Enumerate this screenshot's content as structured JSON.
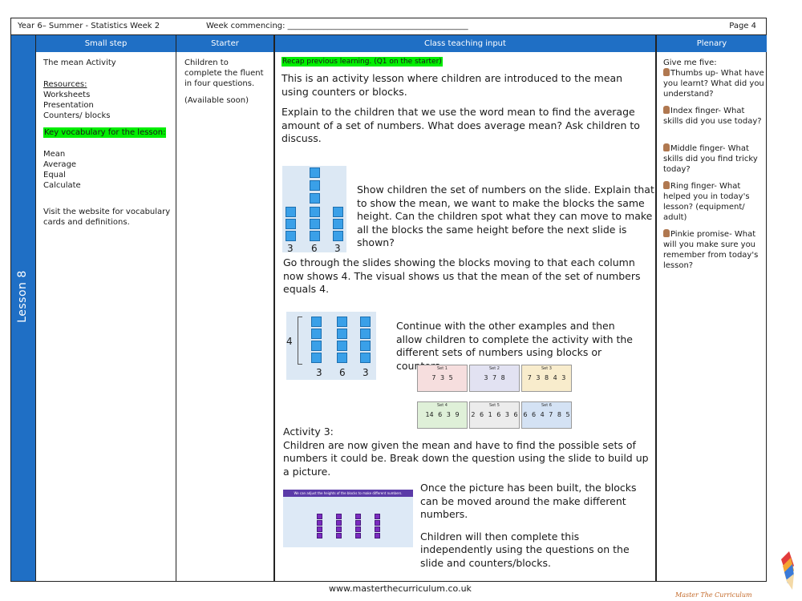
{
  "header": {
    "title": "Year 6– Summer - Statistics Week 2",
    "week_commencing": "Week commencing: _____________________________________________",
    "page": "Page 4"
  },
  "columns": {
    "small_step": "Small step",
    "starter": "Starter",
    "class_teaching": "Class teaching input",
    "plenary": "Plenary"
  },
  "lesson_label": "Lesson 8",
  "small_step": {
    "title": "The mean Activity",
    "resources_heading": "Resources:",
    "resources": [
      "Worksheets",
      "Presentation",
      "Counters/ blocks"
    ],
    "key_vocab_heading": "Key vocabulary for the lesson:",
    "vocab": [
      "Mean",
      "Average",
      "Equal",
      "Calculate"
    ],
    "website_note": "Visit the website for vocabulary cards and definitions."
  },
  "starter": {
    "text": "Children to complete the fluent in four questions.",
    "available": "(Available soon)"
  },
  "teaching": {
    "recap": "Recap previous learning. (Q1 on the starter)",
    "p1": "This is an activity lesson where children are introduced to the mean using counters or blocks.",
    "p2": "Explain to the children that we use the word mean to find the average amount of a set of numbers. What does average mean? Ask children to discuss.",
    "p3": "Show children the set of numbers on the slide. Explain that to show the mean, we want to make the blocks the same height. Can the children spot what they can move to make all the blocks the same height before the next slide is shown?",
    "p4": "Go through the slides showing the blocks moving to that each column now shows 4. The visual shows us that the mean of the set of numbers equals 4.",
    "p5": "Continue with the other examples and then allow children to complete the activity with the different sets of numbers using blocks or counters.",
    "activity_heading": "Activity 3:",
    "p6": "Children are now given the mean and have to find the possible sets of numbers it could be. Break down the question using the slide to build up a picture.",
    "p7": "Once the picture has been built, the blocks can be moved around the make different numbers.",
    "p8": "Children will then complete this independently using the questions on the slide and counters/blocks.",
    "fig1_labels": [
      "3",
      "6",
      "3"
    ],
    "fig2_mean": "4",
    "fig2_labels": [
      "3",
      "6",
      "3"
    ],
    "sets": [
      {
        "title": "Set 1",
        "values": "7   3   5",
        "color": "#f6dede"
      },
      {
        "title": "Set 2",
        "values": "3   7   8",
        "color": "#e2e2f2"
      },
      {
        "title": "Set 3",
        "values": "7 3 8 4 3",
        "color": "#f8eccc"
      },
      {
        "title": "Set 4",
        "values": "14  6  3  9",
        "color": "#dff0d8"
      },
      {
        "title": "Set 5",
        "values": "2 6 1 6 3 6",
        "color": "#ececec"
      },
      {
        "title": "Set 6",
        "values": "6 6 4 7 8 5",
        "color": "#d4e2f4"
      }
    ],
    "purple_slide_title": "We can adjust the heights of the blocks to make different numbers."
  },
  "plenary": {
    "intro": "Give me five:",
    "items": [
      "Thumbs up- What have you learnt? What did you understand?",
      "Index finger- What skills did you use today?",
      "Middle finger- What skills did you find tricky today?",
      "Ring finger- What helped you in today's lesson? (equipment/ adult)",
      "Pinkie promise- What will you make sure you remember from today's lesson?"
    ]
  },
  "footer": {
    "url": "www.masterthecurriculum.co.uk",
    "brand": "Master The Curriculum"
  },
  "colors": {
    "header_blue": "#1f6fc5",
    "highlight_green": "#00ee00",
    "block_blue": "#3aa0e8",
    "block_purple": "#7a2bbf"
  }
}
